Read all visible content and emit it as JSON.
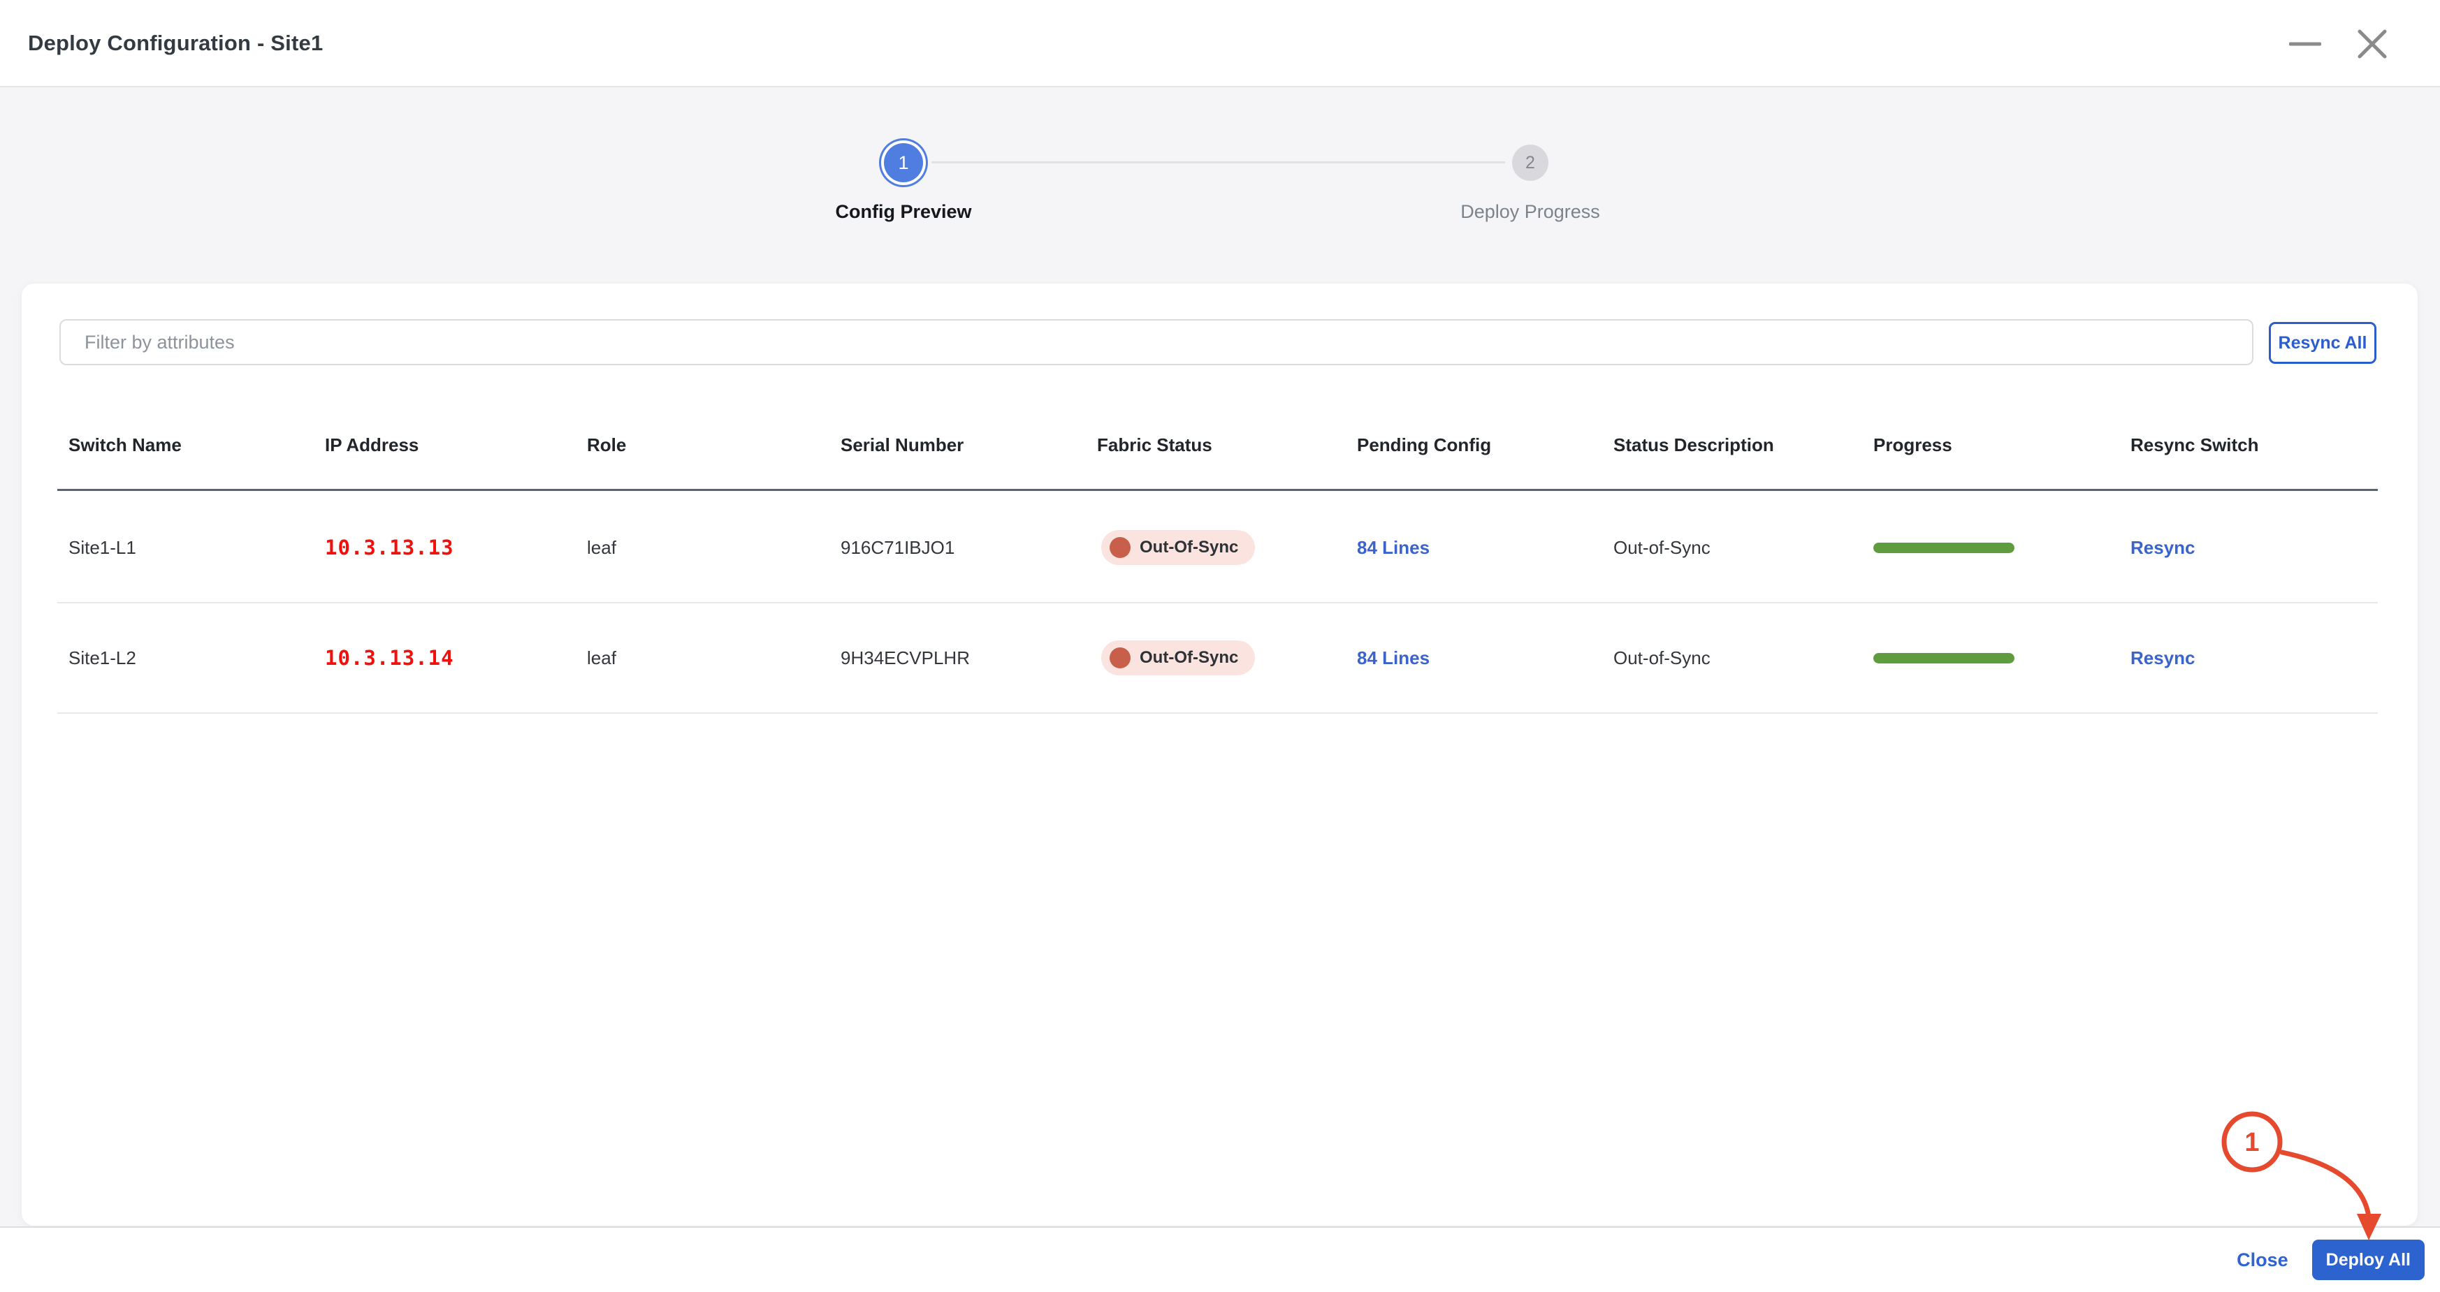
{
  "window": {
    "title": "Deploy Configuration - Site1"
  },
  "stepper": {
    "steps": [
      {
        "number": "1",
        "label": "Config Preview",
        "state": "active"
      },
      {
        "number": "2",
        "label": "Deploy Progress",
        "state": "inactive"
      }
    ]
  },
  "toolbar": {
    "filter_placeholder": "Filter by attributes",
    "resync_all_label": "Resync All"
  },
  "table": {
    "columns": [
      "Switch Name",
      "IP Address",
      "Role",
      "Serial Number",
      "Fabric Status",
      "Pending Config",
      "Status Description",
      "Progress",
      "Resync Switch"
    ],
    "rows": [
      {
        "switch_name": "Site1-L1",
        "ip_address": "10.3.13.13",
        "role": "leaf",
        "serial_number": "916C71IBJO1",
        "fabric_status": "Out-Of-Sync",
        "pending_config": "84 Lines",
        "status_description": "Out-of-Sync",
        "progress_percent": 100,
        "resync_label": "Resync"
      },
      {
        "switch_name": "Site1-L2",
        "ip_address": "10.3.13.14",
        "role": "leaf",
        "serial_number": "9H34ECVPLHR",
        "fabric_status": "Out-Of-Sync",
        "pending_config": "84 Lines",
        "status_description": "Out-of-Sync",
        "progress_percent": 100,
        "resync_label": "Resync"
      }
    ]
  },
  "footer": {
    "close_label": "Close",
    "deploy_all_label": "Deploy All"
  },
  "annotation": {
    "label": "1"
  },
  "colors": {
    "accent_blue": "#2d63cf",
    "link_blue": "#3a63cc",
    "step_active_blue": "#4f7de0",
    "ip_red": "#f1100b",
    "badge_bg": "#fbe4df",
    "badge_dot": "#c75f4b",
    "progress_green": "#5e9c3d",
    "annotation_red": "#e64a2e",
    "header_underline": "#5d646d"
  }
}
